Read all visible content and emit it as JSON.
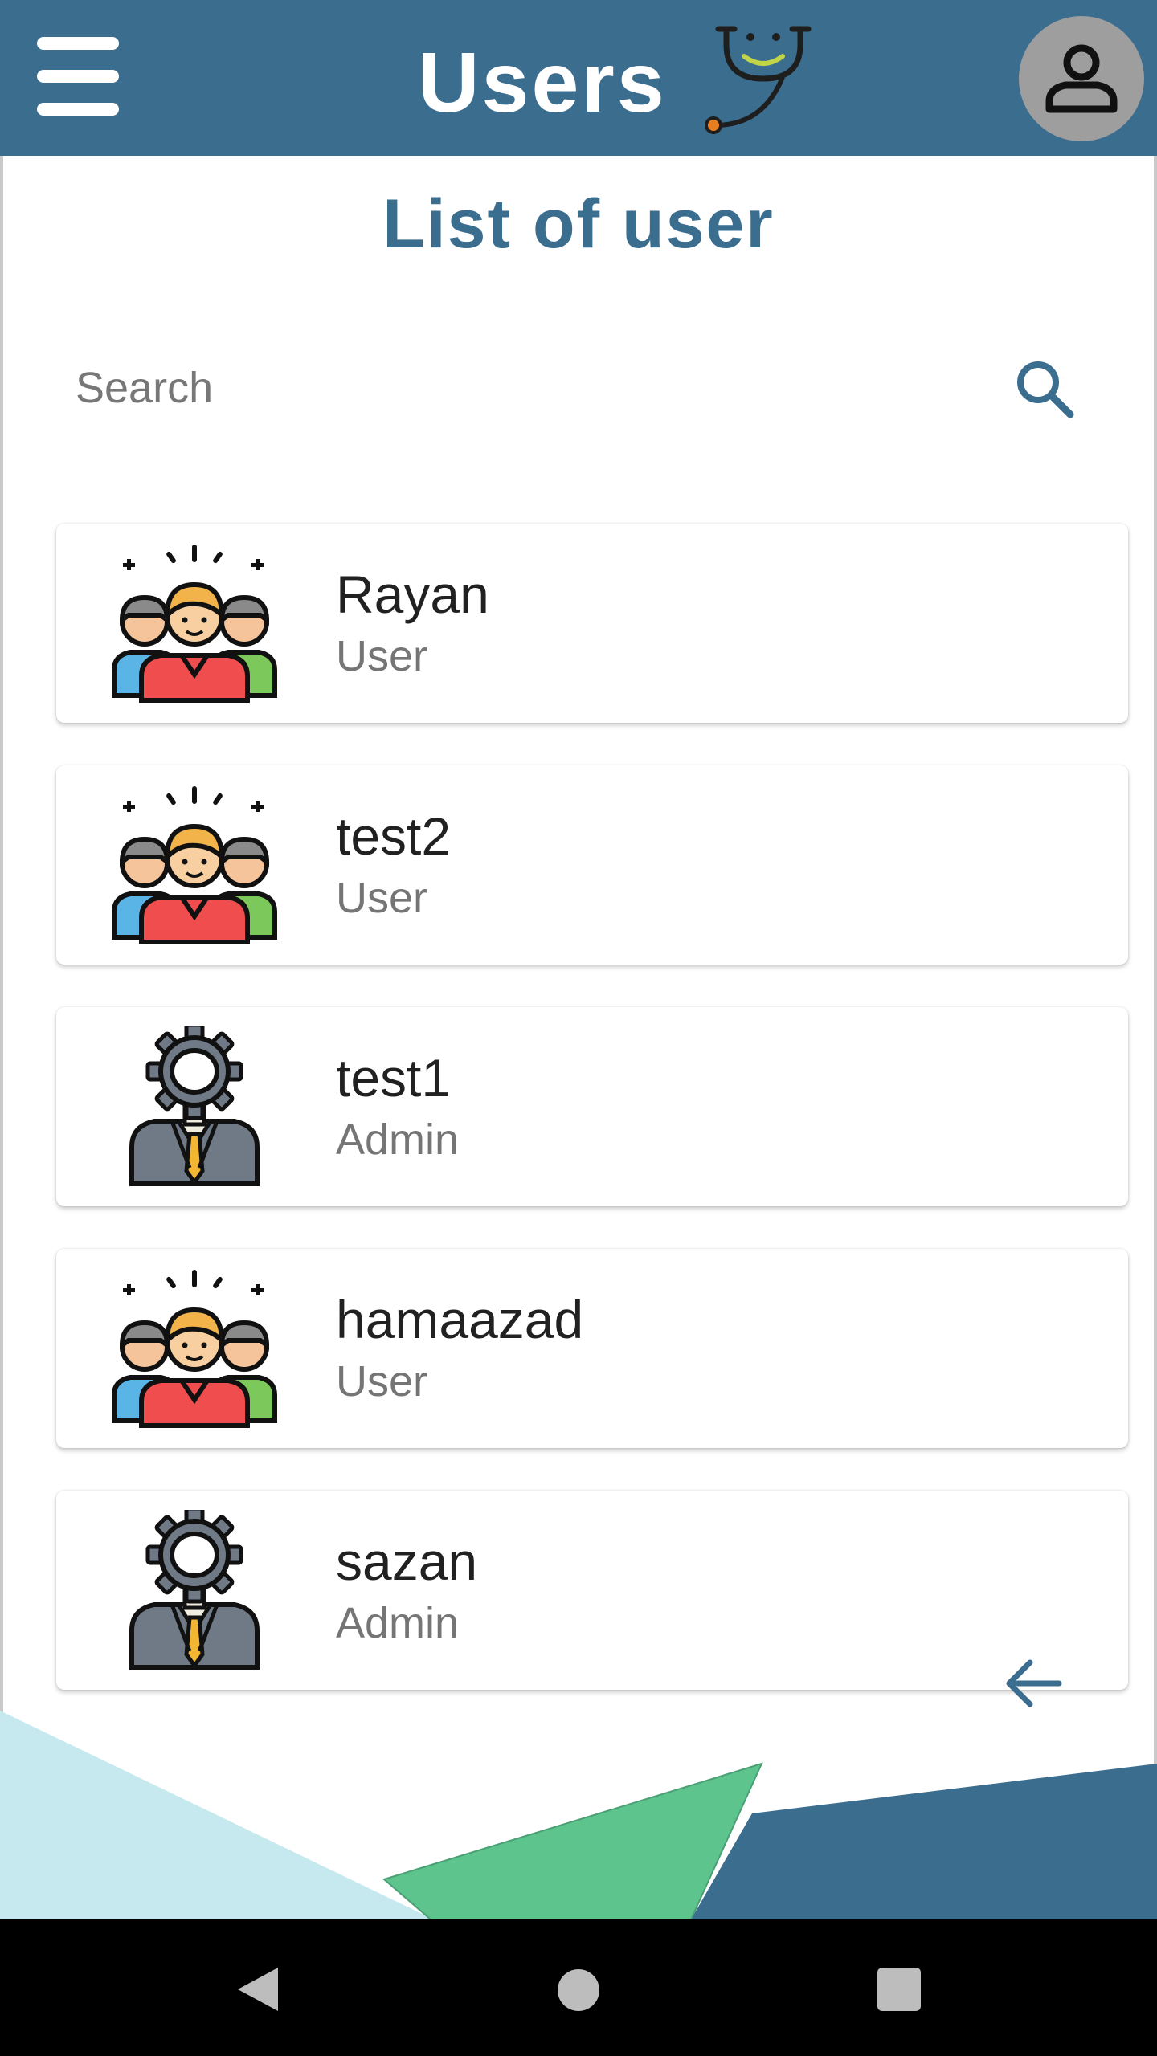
{
  "appbar": {
    "title": "Users",
    "menu_icon": "hamburger-menu-icon",
    "logo_icon": "stethoscope-smile-icon",
    "profile_icon": "person-icon",
    "color": "#3b6d8f"
  },
  "main": {
    "heading": "List of user",
    "search": {
      "placeholder": "Search",
      "value": "",
      "icon": "search-icon"
    },
    "users": [
      {
        "name": "Rayan",
        "role": "User",
        "icon": "team-group-icon"
      },
      {
        "name": "test2",
        "role": "User",
        "icon": "team-group-icon"
      },
      {
        "name": "test1",
        "role": "Admin",
        "icon": "admin-gear-person-icon"
      },
      {
        "name": "hamaazad",
        "role": "User",
        "icon": "team-group-icon"
      },
      {
        "name": "sazan",
        "role": "Admin",
        "icon": "admin-gear-person-icon"
      }
    ],
    "back_icon": "arrow-left-icon"
  },
  "colors": {
    "accent": "#3b6d8f",
    "deco_light": "#c6e9ef",
    "deco_green": "#5cc48c",
    "deco_dark": "#3b6d8f"
  },
  "system_nav": {
    "back_icon": "nav-back-icon",
    "home_icon": "nav-home-icon",
    "recents_icon": "nav-recents-icon"
  }
}
